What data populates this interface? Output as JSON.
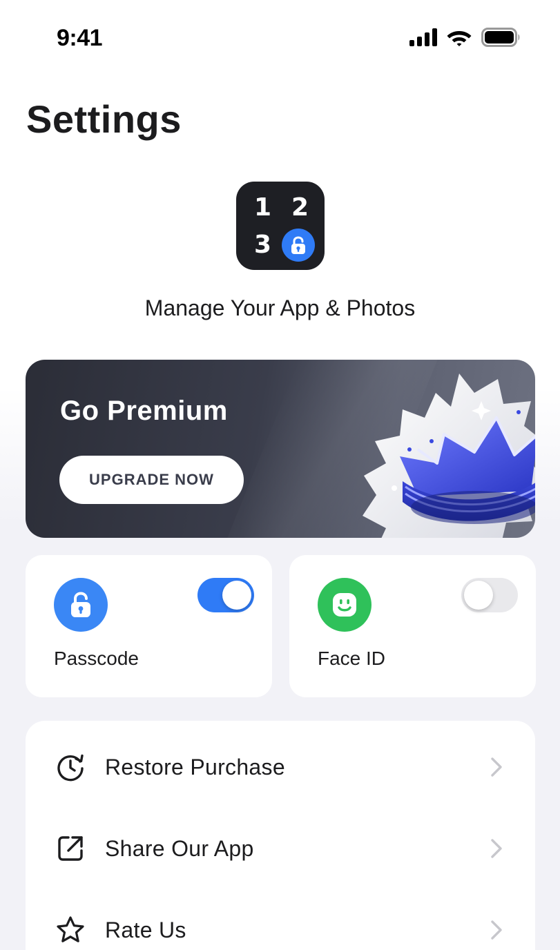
{
  "status_bar": {
    "time": "9:41",
    "icons": [
      "cellular-signal-icon",
      "wifi-icon",
      "battery-icon"
    ]
  },
  "page": {
    "title": "Settings"
  },
  "app_badge": {
    "digits": [
      "1",
      "2",
      "3"
    ],
    "icon": "lock-icon",
    "subtitle": "Manage Your App & Photos"
  },
  "premium": {
    "title": "Go Premium",
    "button_label": "UPGRADE NOW",
    "art": "crown-icon"
  },
  "toggles": [
    {
      "label": "Passcode",
      "icon": "unlock-icon",
      "enabled": true,
      "color": "#3a87f5"
    },
    {
      "label": "Face ID",
      "icon": "face-id-icon",
      "enabled": false,
      "color": "#2fc15a"
    }
  ],
  "menu": {
    "items": [
      {
        "label": "Restore Purchase",
        "icon": "restore-clock-icon"
      },
      {
        "label": "Share Our App",
        "icon": "share-icon"
      },
      {
        "label": "Rate Us",
        "icon": "star-icon"
      }
    ]
  },
  "colors": {
    "accent": "#2f7bf6",
    "premium_dark": "#2b2d37",
    "background": "#f2f2f7"
  }
}
